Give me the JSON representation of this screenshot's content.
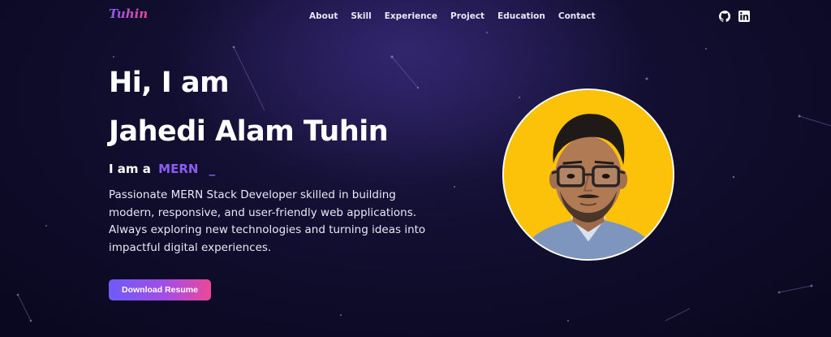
{
  "brand": {
    "logo_text": "Tuhin"
  },
  "nav": {
    "links": [
      {
        "label": "About"
      },
      {
        "label": "Skill"
      },
      {
        "label": "Experience"
      },
      {
        "label": "Project"
      },
      {
        "label": "Education"
      },
      {
        "label": "Contact"
      }
    ],
    "icons": [
      "github-icon",
      "linkedin-icon"
    ]
  },
  "hero": {
    "greeting": "Hi, I am",
    "name": "Jahedi Alam Tuhin",
    "role_prefix": "I am a",
    "role_word": "MERN",
    "cursor": "_",
    "description": "Passionate MERN Stack Developer skilled in building modern, responsive, and user-friendly web applications. Always exploring new technologies and turning ideas into impactful digital experiences.",
    "cta_label": "Download Resume"
  },
  "colors": {
    "accent": "#8b5cf6",
    "accent_pink": "#ec4899",
    "background": "#0b0820",
    "avatar_background": "#fcc20a"
  }
}
